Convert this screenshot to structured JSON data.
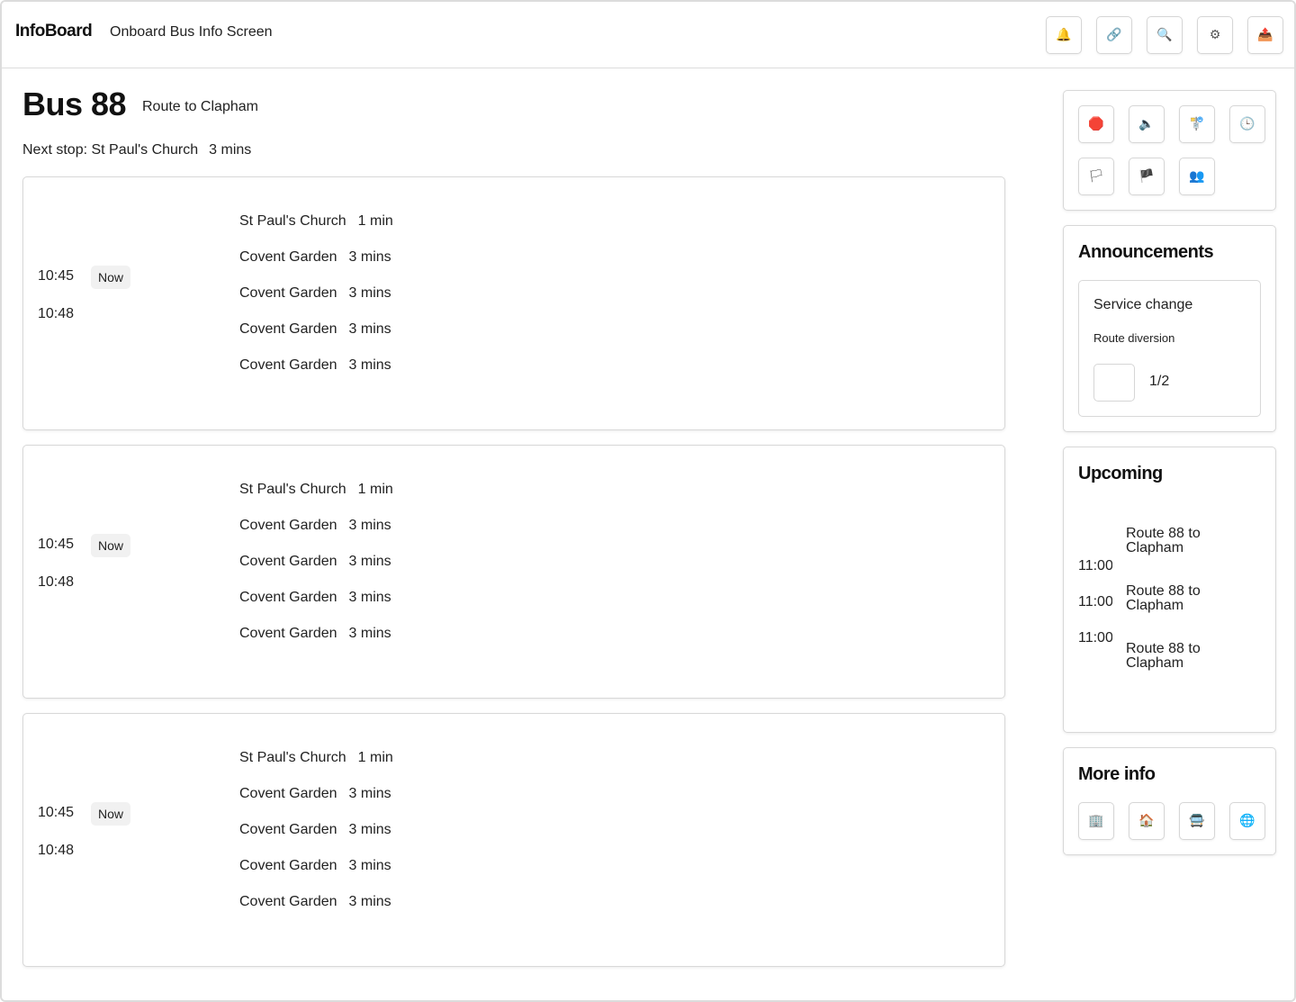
{
  "header": {
    "brand": "InfoBoard",
    "subtitle": "Onboard Bus Info Screen",
    "actions": [
      {
        "name": "bell-icon",
        "glyph": "🔔"
      },
      {
        "name": "link-icon",
        "glyph": "🔗"
      },
      {
        "name": "search-icon",
        "glyph": "🔍"
      },
      {
        "name": "gear-icon",
        "glyph": "⚙"
      },
      {
        "name": "outbox-icon",
        "glyph": "📤"
      }
    ]
  },
  "main": {
    "bus_title": "Bus 88",
    "route": "Route to Clapham",
    "next_stop_label": "Next stop: St Paul's Church",
    "next_stop_eta": "3 mins",
    "trips": [
      {
        "time_now": "10:45",
        "badge": "Now",
        "time_next": "10:48",
        "stops": [
          {
            "name": "St Paul's Church",
            "eta": "1 min"
          },
          {
            "name": "Covent Garden",
            "eta": "3 mins"
          },
          {
            "name": "Covent Garden",
            "eta": "3 mins"
          },
          {
            "name": "Covent Garden",
            "eta": "3 mins"
          },
          {
            "name": "Covent Garden",
            "eta": "3 mins"
          }
        ]
      },
      {
        "time_now": "10:45",
        "badge": "Now",
        "time_next": "10:48",
        "stops": [
          {
            "name": "St Paul's Church",
            "eta": "1 min"
          },
          {
            "name": "Covent Garden",
            "eta": "3 mins"
          },
          {
            "name": "Covent Garden",
            "eta": "3 mins"
          },
          {
            "name": "Covent Garden",
            "eta": "3 mins"
          },
          {
            "name": "Covent Garden",
            "eta": "3 mins"
          }
        ]
      },
      {
        "time_now": "10:45",
        "badge": "Now",
        "time_next": "10:48",
        "stops": [
          {
            "name": "St Paul's Church",
            "eta": "1 min"
          },
          {
            "name": "Covent Garden",
            "eta": "3 mins"
          },
          {
            "name": "Covent Garden",
            "eta": "3 mins"
          },
          {
            "name": "Covent Garden",
            "eta": "3 mins"
          },
          {
            "name": "Covent Garden",
            "eta": "3 mins"
          }
        ]
      }
    ]
  },
  "sidebar": {
    "quick_actions": [
      {
        "name": "stop-sign-icon",
        "glyph": "🛑"
      },
      {
        "name": "speaker-icon",
        "glyph": "🔈"
      },
      {
        "name": "signpost-icon",
        "glyph": "🚏"
      },
      {
        "name": "clock-icon",
        "glyph": "🕒"
      },
      {
        "name": "white-flag-icon",
        "glyph": "🏳"
      },
      {
        "name": "black-flag-icon",
        "glyph": "🏴"
      },
      {
        "name": "people-icon",
        "glyph": "👥"
      }
    ],
    "announcements": {
      "title": "Announcements",
      "item_title": "Service change",
      "item_subtitle": "Route diversion",
      "page": "1/2"
    },
    "upcoming": {
      "title": "Upcoming",
      "times": [
        "11:00",
        "11:00",
        "11:00"
      ],
      "routes": [
        "Route 88 to Clapham",
        "Route 88 to Clapham",
        "Route 88 to Clapham"
      ]
    },
    "more_info": {
      "title": "More info",
      "links": [
        {
          "name": "office-building-icon",
          "glyph": "🏢"
        },
        {
          "name": "house-icon",
          "glyph": "🏠"
        },
        {
          "name": "bus-icon",
          "glyph": "🚍"
        },
        {
          "name": "globe-icon",
          "glyph": "🌐"
        }
      ]
    }
  }
}
